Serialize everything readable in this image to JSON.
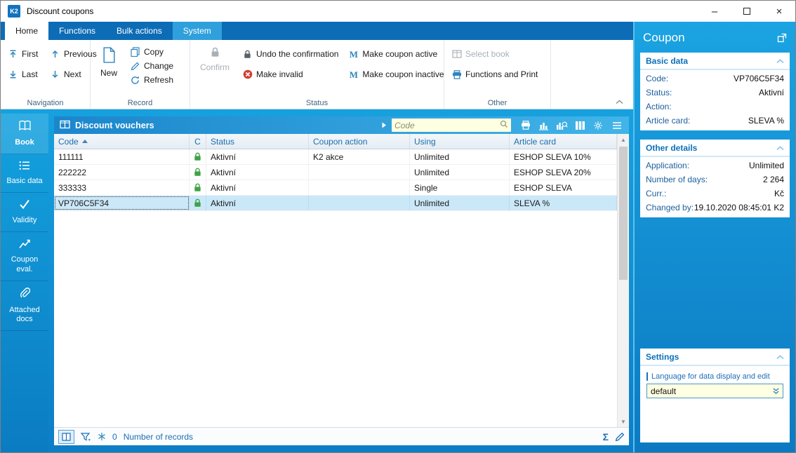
{
  "window": {
    "title": "Discount coupons",
    "logo": "K2",
    "controls": {
      "minimize": "–",
      "close": "×"
    }
  },
  "ribbon": {
    "tabs": [
      {
        "label": "Home"
      },
      {
        "label": "Functions"
      },
      {
        "label": "Bulk actions"
      },
      {
        "label": "System"
      }
    ],
    "navigation": {
      "first": "First",
      "previous": "Previous",
      "last": "Last",
      "next": "Next",
      "group_label": "Navigation"
    },
    "record": {
      "new": "New",
      "copy": "Copy",
      "change": "Change",
      "refresh": "Refresh",
      "group_label": "Record"
    },
    "status": {
      "confirm": "Confirm",
      "undo": "Undo the confirmation",
      "make_invalid": "Make invalid",
      "make_active": "Make coupon active",
      "make_inactive": "Make coupon inactive",
      "m_glyph": "M",
      "group_label": "Status"
    },
    "other": {
      "select_book": "Select book",
      "functions_print": "Functions and Print",
      "group_label": "Other"
    }
  },
  "sidebar": {
    "items": [
      {
        "label": "Book"
      },
      {
        "label": "Basic data"
      },
      {
        "label": "Validity"
      },
      {
        "label": "Coupon eval."
      },
      {
        "label": "Attached docs"
      }
    ]
  },
  "browse": {
    "title": "Discount vouchers",
    "search_placeholder": "Code"
  },
  "table": {
    "columns": {
      "code": "Code",
      "c": "C",
      "status": "Status",
      "action": "Coupon action",
      "using": "Using",
      "article": "Article card"
    },
    "rows": [
      {
        "code": "111111",
        "status": "Aktivní",
        "action": "K2 akce",
        "using": "Unlimited",
        "article": "ESHOP SLEVA 10%"
      },
      {
        "code": "222222",
        "status": "Aktivní",
        "action": "",
        "using": "Unlimited",
        "article": "ESHOP SLEVA 20%"
      },
      {
        "code": "333333",
        "status": "Aktivní",
        "action": "",
        "using": "Single",
        "article": "ESHOP SLEVA"
      },
      {
        "code": "VP706C5F34",
        "status": "Aktivní",
        "action": "",
        "using": "Unlimited",
        "article": "SLEVA %"
      }
    ]
  },
  "statusbar": {
    "count": "0",
    "records_label": "Number of records",
    "sum_glyph": "Σ"
  },
  "panel": {
    "title": "Coupon",
    "basic": {
      "title": "Basic data",
      "fields": [
        {
          "label": "Code:",
          "value": "VP706C5F34"
        },
        {
          "label": "Status:",
          "value": "Aktivní"
        },
        {
          "label": "Action:",
          "value": ""
        },
        {
          "label": "Article card:",
          "value": "SLEVA %"
        }
      ]
    },
    "other": {
      "title": "Other details",
      "fields": [
        {
          "label": "Application:",
          "value": "Unlimited"
        },
        {
          "label": "Number of days:",
          "value": "2 264"
        },
        {
          "label": "Curr.:",
          "value": "Kč"
        },
        {
          "label": "Changed by:",
          "value": "19.10.2020 08:45:01 K2"
        }
      ]
    },
    "settings": {
      "title": "Settings",
      "language_label": "Language for data display and edit",
      "language_value": "default"
    }
  },
  "colors": {
    "accent": "#1d6fb8",
    "tab_strip": "#0d6cb6",
    "selected_row": "#cbe8f9",
    "search_bg": "#ffffe1",
    "lock_green": "#3fa247",
    "invalid_red": "#d23f31"
  }
}
